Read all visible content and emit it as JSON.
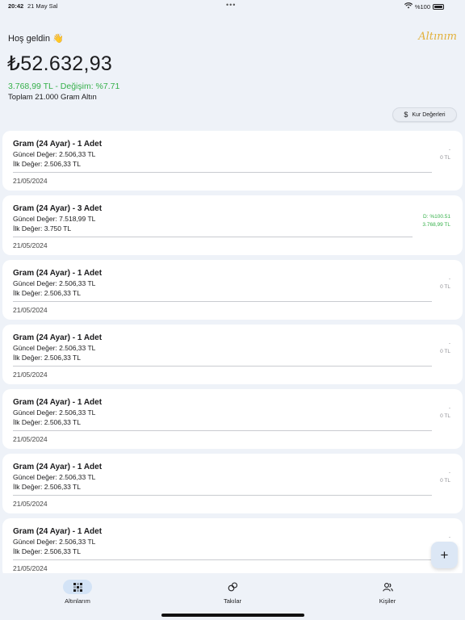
{
  "status": {
    "time": "20:42",
    "date": "21 May Sal",
    "battery": "%100"
  },
  "header": {
    "greeting": "Hoş geldin 👋",
    "brand": "Altınım",
    "total": "₺52.632,93",
    "change": "3.768,99 TL - Değişim: %7.71",
    "gram_total": "Toplam 21.000 Gram Altın",
    "rates_button": "Kur Değerleri"
  },
  "cards": [
    {
      "title": "Gram (24 Ayar) - 1 Adet",
      "current": "Güncel Değer: 2.506,33 TL",
      "initial": "İlk Değer: 2.506,33 TL",
      "date": "21/05/2024",
      "diff_line1": "-",
      "diff_line2": "0 TL"
    },
    {
      "title": "Gram (24 Ayar) - 3 Adet",
      "current": "Güncel Değer: 7.518,99 TL",
      "initial": "İlk Değer: 3.750 TL",
      "date": "21/05/2024",
      "diff_line1": "D: %100.51",
      "diff_line2": "3.768,99 TL"
    },
    {
      "title": "Gram (24 Ayar) - 1 Adet",
      "current": "Güncel Değer: 2.506,33 TL",
      "initial": "İlk Değer: 2.506,33 TL",
      "date": "21/05/2024",
      "diff_line1": "-",
      "diff_line2": "0 TL"
    },
    {
      "title": "Gram (24 Ayar) - 1 Adet",
      "current": "Güncel Değer: 2.506,33 TL",
      "initial": "İlk Değer: 2.506,33 TL",
      "date": "21/05/2024",
      "diff_line1": "-",
      "diff_line2": "0 TL"
    },
    {
      "title": "Gram (24 Ayar) - 1 Adet",
      "current": "Güncel Değer: 2.506,33 TL",
      "initial": "İlk Değer: 2.506,33 TL",
      "date": "21/05/2024",
      "diff_line1": "-",
      "diff_line2": "0 TL"
    },
    {
      "title": "Gram (24 Ayar) - 1 Adet",
      "current": "Güncel Değer: 2.506,33 TL",
      "initial": "İlk Değer: 2.506,33 TL",
      "date": "21/05/2024",
      "diff_line1": "-",
      "diff_line2": "0 TL"
    },
    {
      "title": "Gram (24 Ayar) - 1 Adet",
      "current": "Güncel Değer: 2.506,33 TL",
      "initial": "İlk Değer: 2.506,33 TL",
      "date": "21/05/2024",
      "diff_line1": "-",
      "diff_line2": ""
    }
  ],
  "fab": {
    "label": "+"
  },
  "tabs": [
    {
      "label": "Altınlarım",
      "icon": "grid-icon",
      "active": true
    },
    {
      "label": "Takılar",
      "icon": "rings-icon",
      "active": false
    },
    {
      "label": "Kişiler",
      "icon": "people-icon",
      "active": false
    }
  ],
  "colors": {
    "accent": "#35b04a",
    "brand": "#e2b13c",
    "background": "#eef2f8",
    "tab_active": "#d3e3f6"
  }
}
